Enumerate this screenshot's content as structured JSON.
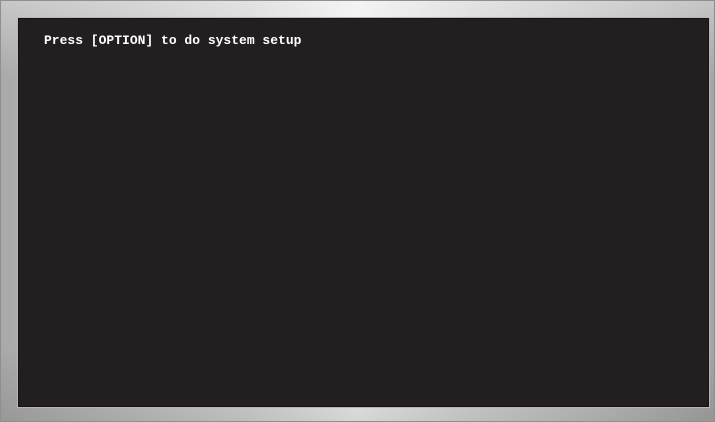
{
  "screen": {
    "message": "Press [OPTION] to do system setup",
    "background_color": "#231f20",
    "text_color": "#ffffff"
  },
  "bezel": {
    "color": "silver"
  }
}
